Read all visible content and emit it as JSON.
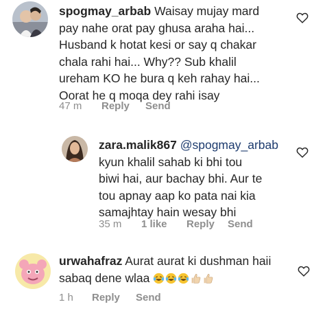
{
  "comments": [
    {
      "username": "spogmay_arbab",
      "lines": [
        "Waisay mujay mard",
        "pay nahe orat pay ghusa araha hai...",
        "Husband k hotat kesi or say q chakar",
        "chala rahi hai... Why?? Sub khalil",
        "ureham KO he bura q keh rahay hai...",
        "Oorat he q moqa dey rahi isay"
      ],
      "time": "47 m",
      "reply": "Reply",
      "send": "Send",
      "avatar_icon": "profile-photo"
    },
    {
      "username": "zara.malik867",
      "mention": "@spogmay_arbab",
      "lines": [
        "kyun khalil sahab ki bhi tou",
        "biwi hai, aur bachay bhi. Aur te",
        "tou apnay aap ko pata nai kia",
        "samajhtay hain wesay bhi"
      ],
      "time": "35 m",
      "likes": "1 like",
      "reply": "Reply",
      "send": "Send",
      "avatar_icon": "profile-photo"
    },
    {
      "username": "urwahafraz",
      "lines": [
        "Aurat aurat ki dushman haii",
        "sabaq dene wlaa"
      ],
      "emojis": [
        "laughing-crying-emoji",
        "laughing-crying-emoji",
        "laughing-crying-emoji",
        "thumbs-up-emoji",
        "thumbs-up-emoji"
      ],
      "time": "1 h",
      "reply": "Reply",
      "send": "Send",
      "avatar_icon": "pink-cartoon-avatar"
    }
  ],
  "colors": {
    "text": "#262626",
    "meta": "#8e8e8e",
    "mention": "#1d3b6e",
    "heart": "#262626"
  }
}
